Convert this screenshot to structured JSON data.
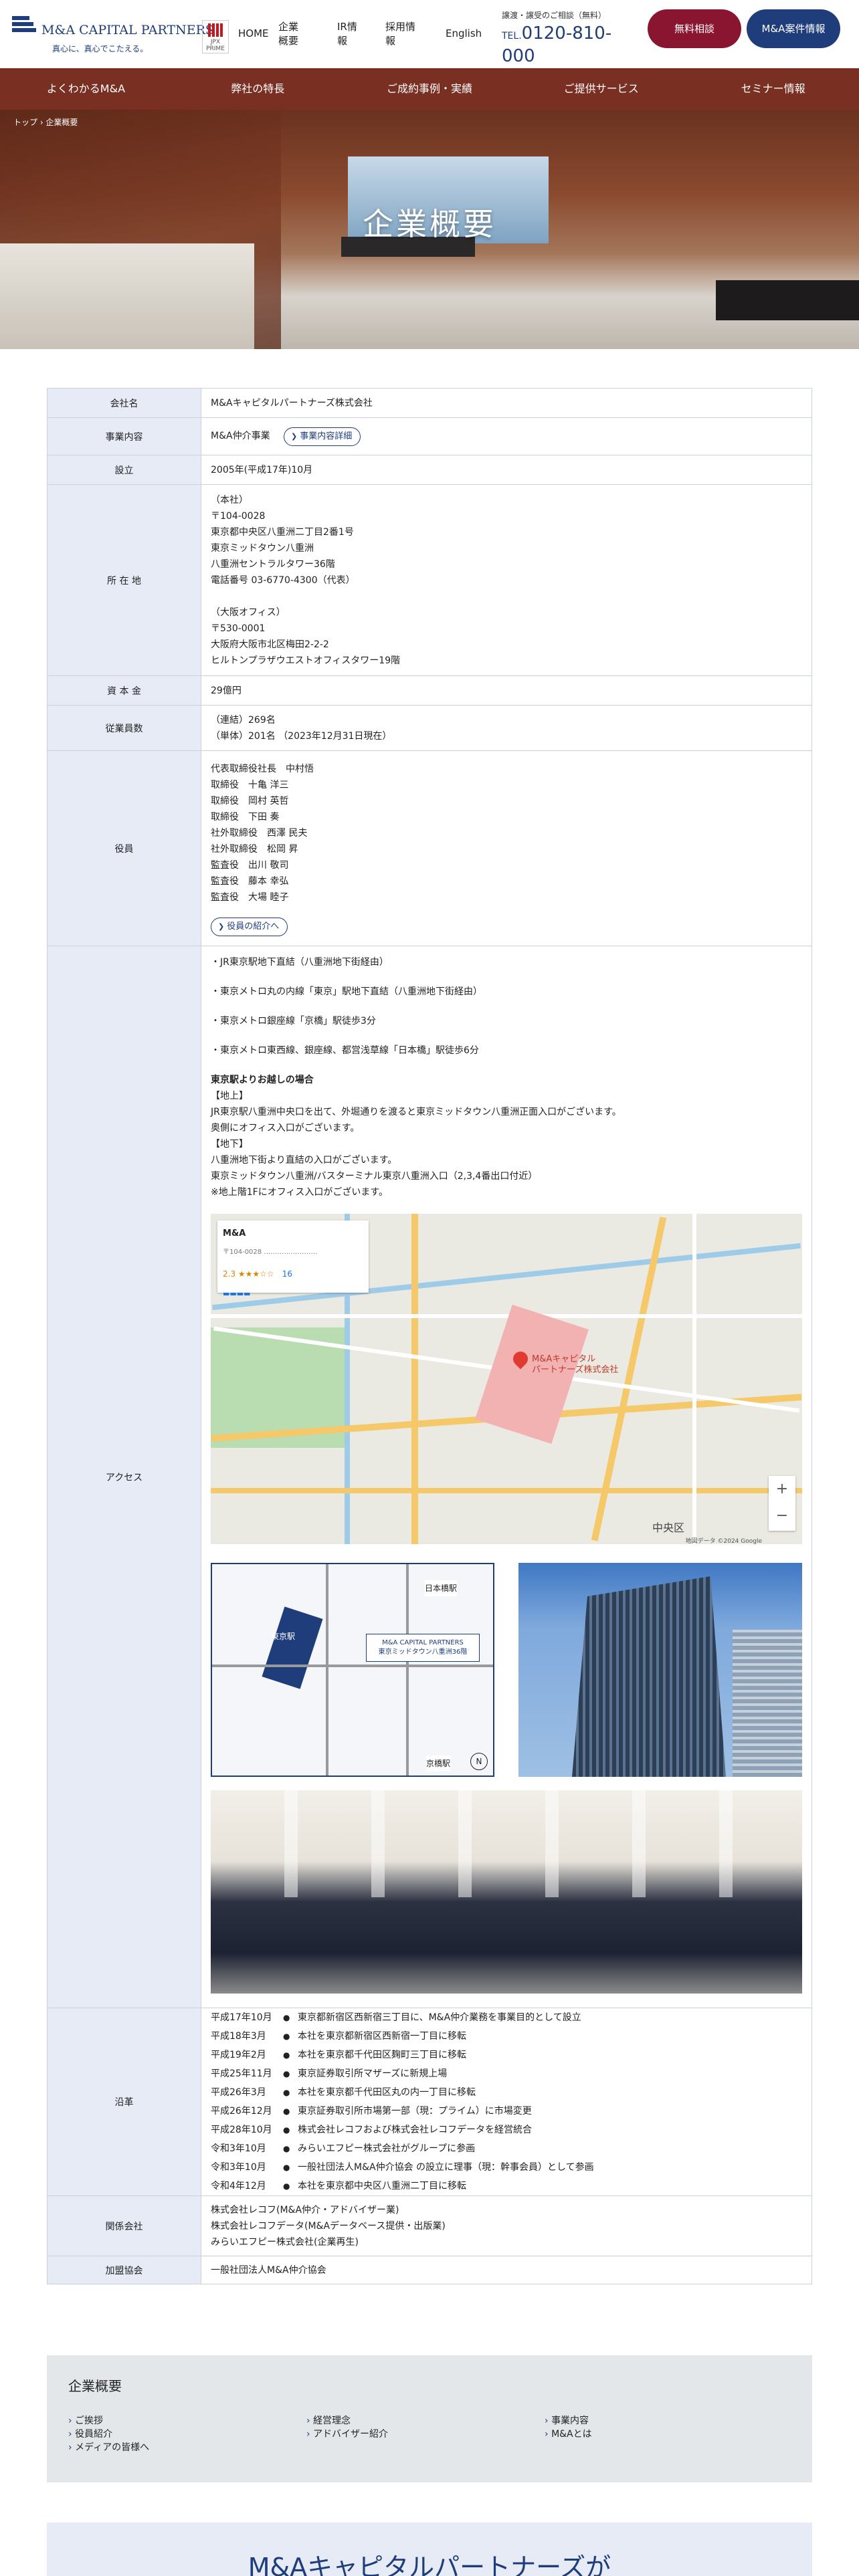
{
  "header": {
    "logo_name": "M&A CAPITAL PARTNERS",
    "logo_tagline": "真心に、真心でこたえる。",
    "jpx_label": "JPX PRIME",
    "nav": [
      {
        "label": "HOME"
      },
      {
        "label": "企業概要"
      },
      {
        "label": "IR情報"
      },
      {
        "label": "採用情報"
      },
      {
        "label": "English"
      }
    ],
    "phone_note": "譲渡・譲受のご相談（無料）",
    "phone_prefix": "TEL.",
    "phone_number": "0120-810-000",
    "btn_consult": "無料相談",
    "btn_cases": "M&A案件情報"
  },
  "gnav": [
    "よくわかるM&A",
    "弊社の特長",
    "ご成約事例・実績",
    "ご提供サービス",
    "セミナー情報"
  ],
  "hero": {
    "breadcrumb": "トップ  ›  企業概要",
    "title": "企業概要"
  },
  "table": {
    "company_name": {
      "label": "会社名",
      "value": "M&Aキャピタルパートナーズ株式会社"
    },
    "business": {
      "label": "事業内容",
      "value": "M&A仲介事業",
      "button": "事業内容詳細"
    },
    "founded": {
      "label": "設立",
      "value": "2005年(平成17年)10月"
    },
    "address": {
      "label": "所 在 地",
      "value": "（本社）\n〒104-0028\n東京都中央区八重洲二丁目2番1号\n東京ミッドタウン八重洲\n八重洲セントラルタワー36階\n電話番号 03-6770-4300（代表）\n\n（大阪オフィス）\n〒530-0001\n大阪府大阪市北区梅田2-2-2\nヒルトンプラザウエストオフィスタワー19階"
    },
    "capital": {
      "label": "資 本 金",
      "value": "29億円"
    },
    "employees": {
      "label": "従業員数",
      "value": "（連結）269名\n（単体）201名 （2023年12月31日現在）"
    },
    "officers": {
      "label": "役員",
      "value": "代表取締役社長　中村悟\n取締役　十亀 洋三\n取締役　岡村 英哲\n取締役　下田 奏\n社外取締役　西澤 民夫\n社外取締役　松岡 昇\n監査役　出川 敬司\n監査役　藤本 幸弘\n監査役　大場 睦子",
      "button": "役員の紹介へ"
    },
    "access": {
      "label": "アクセス",
      "lines": [
        "・JR東京駅地下直結（八重洲地下街経由）",
        "・東京メトロ丸の内線「東京」駅地下直結（八重洲地下街経由）",
        "・東京メトロ銀座線「京橋」駅徒歩3分",
        "・東京メトロ東西線、銀座線、都営浅草線「日本橋」駅徒歩6分"
      ],
      "route_title": "東京駅よりお越しの場合",
      "route_text": "【地上】\nJR東京駅八重洲中央口を出て、外堀通りを渡ると東京ミッドタウン八重洲正面入口がございます。\n奥側にオフィス入口がございます。\n【地下】\n八重洲地下街より直結の入口がございます。\n東京ミッドタウン八重洲/バスターミナル東京八重洲入口（2,3,4番出口付近）\n※地上階1Fにオフィス入口がございます。",
      "map": {
        "card_title": "M&A",
        "card_address": "〒104-0028 ……………………",
        "rating": "2.3 ★★★☆☆",
        "reviews": "16",
        "pin_label": "M&Aキャピタル\nパートナーズ株式会社",
        "ward": "中央区",
        "credit": "地図データ ©2024 Google",
        "zoom_in": "+",
        "zoom_out": "−"
      },
      "mini_map": {
        "box_line1": "M&A CAPITAL PARTNERS",
        "box_line2": "東京ミッドタウン八重洲36階",
        "label_nihonbashi": "日本橋駅",
        "label_tokyo": "東京駅",
        "label_kyobashi": "京橋駅",
        "compass": "N"
      }
    },
    "history": {
      "label": "沿革",
      "items": [
        {
          "year": "平成17年10月",
          "text": "東京都新宿区西新宿三丁目に、M&A仲介業務を事業目的として設立"
        },
        {
          "year": "平成18年3月",
          "text": "本社を東京都新宿区西新宿一丁目に移転"
        },
        {
          "year": "平成19年2月",
          "text": "本社を東京都千代田区麹町三丁目に移転"
        },
        {
          "year": "平成25年11月",
          "text": "東京証券取引所マザーズに新規上場"
        },
        {
          "year": "平成26年3月",
          "text": "本社を東京都千代田区丸の内一丁目に移転"
        },
        {
          "year": "平成26年12月",
          "text": "東京証券取引所市場第一部（現：プライム）に市場変更"
        },
        {
          "year": "平成28年10月",
          "text": "株式会社レコフおよび株式会社レコフデータを経営統合"
        },
        {
          "year": "令和3年10月",
          "text": "みらいエフピー株式会社がグループに参画"
        },
        {
          "year": "令和3年10月",
          "text": "一般社団法人M&A仲介協会 の設立に理事（現：幹事会員）として参画"
        },
        {
          "year": "令和4年12月",
          "text": "本社を東京都中央区八重洲二丁目に移転"
        }
      ]
    },
    "affiliates": {
      "label": "関係会社",
      "value": "株式会社レコフ(M&A仲介・アドバイザー業)\n株式会社レコフデータ(M&Aデータベース提供・出版業)\nみらいエフピー株式会社(企業再生)"
    },
    "association": {
      "label": "加盟協会",
      "value": "一般社団法人M&A仲介協会"
    }
  },
  "sitemap": {
    "title": "企業概要",
    "col1": [
      "ご挨拶",
      "役員紹介",
      "メディアの皆様へ"
    ],
    "col2": [
      "経営理念",
      "アドバイザー紹介"
    ],
    "col3": [
      "事業内容",
      "M&Aとは"
    ]
  },
  "cta": {
    "title": "M&Aキャピタルパートナーズが"
  },
  "colors": {
    "brand_navy": "#1f3d7a",
    "nav_brown": "#7a2f23",
    "consult_red": "#8a1530",
    "table_header": "#e6ebf5"
  }
}
